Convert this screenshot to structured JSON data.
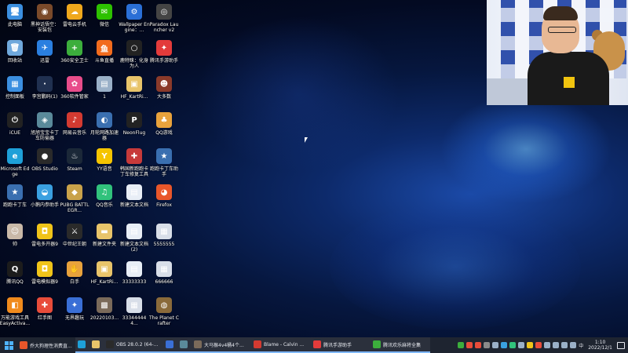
{
  "desktop": {
    "icons": [
      {
        "label": "此电脑",
        "color": "#3b8fe0",
        "glyph": "🖥"
      },
      {
        "label": "黑神话悟空：安装包",
        "color": "#7a4a2a",
        "glyph": "◉"
      },
      {
        "label": "雷电云手机",
        "color": "#f0a81c",
        "glyph": "☁"
      },
      {
        "label": "微信",
        "color": "#2dc100",
        "glyph": "✉"
      },
      {
        "label": "Wallpaper Engine：...",
        "color": "#2a6fd6",
        "glyph": "⚙"
      },
      {
        "label": "Paradox Launcher v2",
        "color": "#444444",
        "glyph": "◎"
      },
      {
        "label": "回收站",
        "color": "#6fa8dc",
        "glyph": "🗑"
      },
      {
        "label": "迅雷",
        "color": "#2a7fe0",
        "glyph": "✈"
      },
      {
        "label": "360安全卫士",
        "color": "#3cae3c",
        "glyph": "+"
      },
      {
        "label": "斗鱼直播",
        "color": "#f26b1d",
        "glyph": "鱼"
      },
      {
        "label": "鹿特睐：化身为人",
        "color": "#222222",
        "glyph": "○"
      },
      {
        "label": "腾讯手游助手",
        "color": "#e33b3b",
        "glyph": "✦"
      },
      {
        "label": "控制面板",
        "color": "#3b8fe0",
        "glyph": "▦"
      },
      {
        "label": "李宫鹏码(1)",
        "color": "#203050",
        "glyph": "·"
      },
      {
        "label": "360软件管家",
        "color": "#e84c8a",
        "glyph": "✿"
      },
      {
        "label": "1",
        "color": "#9ab0c8",
        "glyph": "▤"
      },
      {
        "label": "HF_KartRi...",
        "color": "#e8c46a",
        "glyph": "▣"
      },
      {
        "label": "大多数",
        "color": "#8a3a2a",
        "glyph": "☻"
      },
      {
        "label": "iCUE",
        "color": "#222222",
        "glyph": "⏻"
      },
      {
        "label": "旭旭宝宝卡丁车防偷器",
        "color": "#5a8a9a",
        "glyph": "◈"
      },
      {
        "label": "网易云音乐",
        "color": "#d33a31",
        "glyph": "♪"
      },
      {
        "label": "月轮网路加速器",
        "color": "#3a6fb0",
        "glyph": "◐"
      },
      {
        "label": "NeonFlug",
        "color": "#222222",
        "glyph": "P"
      },
      {
        "label": "QQ游戏",
        "color": "#e8a23c",
        "glyph": "♣"
      },
      {
        "label": "Microsoft Edge",
        "color": "#1ea0d8",
        "glyph": "e"
      },
      {
        "label": "OBS Studio",
        "color": "#2a2a2a",
        "glyph": "●"
      },
      {
        "label": "Steam",
        "color": "#1b2838",
        "glyph": "♨"
      },
      {
        "label": "YY语音",
        "color": "#f5c400",
        "glyph": "Y"
      },
      {
        "label": "韩国新跑跑卡丁车修复工具",
        "color": "#c73a3a",
        "glyph": "✚"
      },
      {
        "label": "跑跑卡丁车助手",
        "color": "#3a6fb0",
        "glyph": "★"
      },
      {
        "label": "跑跑卡丁车",
        "color": "#3a6fb0",
        "glyph": "★"
      },
      {
        "label": "小鹅内参助手",
        "color": "#3aa0e0",
        "glyph": "◒"
      },
      {
        "label": "PUBG BATTLEGR...",
        "color": "#c9a24a",
        "glyph": "◆"
      },
      {
        "label": "QQ音乐",
        "color": "#31c27c",
        "glyph": "♫"
      },
      {
        "label": "新建文本文档",
        "color": "#e8eef6",
        "glyph": "▤"
      },
      {
        "label": "Firefox",
        "color": "#e8562a",
        "glyph": "◕"
      },
      {
        "label": "帅",
        "color": "#c9b9a8",
        "glyph": "☺"
      },
      {
        "label": "雷电多开器9",
        "color": "#f0c419",
        "glyph": "◘"
      },
      {
        "label": "中世纪王朝",
        "color": "#2a2a2a",
        "glyph": "⚔"
      },
      {
        "label": "新建文件夹",
        "color": "#e8c46a",
        "glyph": "▬"
      },
      {
        "label": "新建文本文档 (2)",
        "color": "#e8eef6",
        "glyph": "▤"
      },
      {
        "label": "5555555",
        "color": "#d8dee8",
        "glyph": "▦"
      },
      {
        "label": "腾讯QQ",
        "color": "#1c1c1c",
        "glyph": "Q"
      },
      {
        "label": "雷电模拟器9",
        "color": "#f0c419",
        "glyph": "◘"
      },
      {
        "label": "白手",
        "color": "#e8a23c",
        "glyph": "✋"
      },
      {
        "label": "HF_KartRi...",
        "color": "#e8c46a",
        "glyph": "▣"
      },
      {
        "label": "33333333",
        "color": "#e8eef6",
        "glyph": "▤"
      },
      {
        "label": "666666",
        "color": "#d8dee8",
        "glyph": "▦"
      },
      {
        "label": "万能游戏工具 EasyActiva...",
        "color": "#f08a1c",
        "glyph": "◧"
      },
      {
        "label": "红手图",
        "color": "#e84c3a",
        "glyph": "✚"
      },
      {
        "label": "无界趣玩",
        "color": "#3a6fd6",
        "glyph": "✦"
      },
      {
        "label": "20220103...",
        "color": "#7a6a5a",
        "glyph": "▩"
      },
      {
        "label": "333444444...",
        "color": "#d8dee8",
        "glyph": "▦"
      },
      {
        "label": "The Planet Crafter",
        "color": "#8a6a3a",
        "glyph": "◍"
      }
    ]
  },
  "taskbar": {
    "items": [
      {
        "label": "乔大狗理性消费直...",
        "color": "#e8562a",
        "app": false
      },
      {
        "label": "",
        "color": "#1ea0d8",
        "app": true
      },
      {
        "label": "",
        "color": "#e8c46a",
        "app": true
      },
      {
        "label": "OBS 28.0.2 (64-...",
        "color": "#2a2a2a",
        "app": true
      },
      {
        "label": "",
        "color": "#3a6fd6",
        "app": true
      },
      {
        "label": "",
        "color": "#5a8a9a",
        "app": true
      },
      {
        "label": "大马猴4v4桶4个...",
        "color": "#7a6a5a",
        "app": true
      },
      {
        "label": "Blame - Calvin ...",
        "color": "#d33a31",
        "app": true
      },
      {
        "label": "腾讯手游助手",
        "color": "#e33b3b",
        "app": true
      },
      {
        "label": "腾讯欢乐麻将全集",
        "color": "#3cae3c",
        "app": true
      }
    ],
    "tray": {
      "icon_colors": [
        "#3cae3c",
        "#e84c3a",
        "#e84c3a",
        "#8a8a8a",
        "#9ab0c8",
        "#3aa0e0",
        "#31c27c",
        "#9ab0c8",
        "#f0c419",
        "#e84c3a",
        "#9ab0c8",
        "#9ab0c8",
        "#9ab0c8",
        "#9ab0c8"
      ],
      "ime": "中",
      "time": "1:10",
      "date": "2022/12/1"
    }
  }
}
